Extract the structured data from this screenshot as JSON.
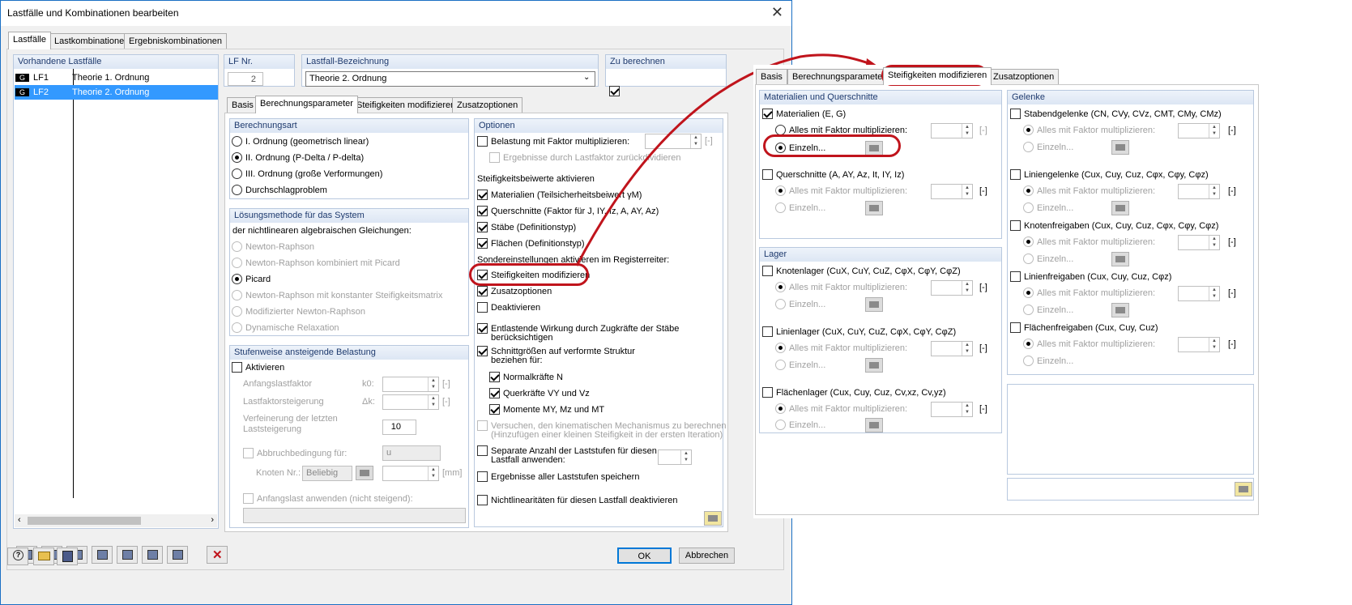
{
  "window": {
    "title": "Lastfälle und Kombinationen bearbeiten"
  },
  "top_tabs": [
    "Lastfälle",
    "Lastkombinationen",
    "Ergebniskombinationen"
  ],
  "loadcases": {
    "header": "Vorhandene Lastfälle",
    "items": [
      {
        "tag": "G",
        "id": "LF1",
        "name": "Theorie 1. Ordnung"
      },
      {
        "tag": "G",
        "id": "LF2",
        "name": "Theorie 2. Ordnung"
      }
    ]
  },
  "lf_nr": {
    "label": "LF Nr.",
    "value": "2"
  },
  "bezeichnung": {
    "label": "Lastfall-Bezeichnung",
    "value": "Theorie 2. Ordnung"
  },
  "zu_berechnen": {
    "label": "Zu berechnen"
  },
  "inner_tabs": [
    "Basis",
    "Berechnungsparameter",
    "Steifigkeiten modifizieren",
    "Zusatzoptionen"
  ],
  "berechnungsart": {
    "header": "Berechnungsart",
    "options": [
      "I. Ordnung (geometrisch linear)",
      "II. Ordnung (P-Delta / P-delta)",
      "III. Ordnung (große Verformungen)",
      "Durchschlagproblem"
    ]
  },
  "loesung": {
    "header": "Lösungsmethode für das System",
    "intro": "der nichtlinearen algebraischen Gleichungen:",
    "options": [
      "Newton-Raphson",
      "Newton-Raphson kombiniert mit Picard",
      "Picard",
      "Newton-Raphson mit konstanter Steifigkeitsmatrix",
      "Modifizierter Newton-Raphson",
      "Dynamische Relaxation"
    ]
  },
  "stufen": {
    "header": "Stufenweise ansteigende Belastung",
    "aktivieren": "Aktivieren",
    "anfang": "Anfangslastfaktor",
    "anfang_sym": "k0:",
    "steig": "Lastfaktorsteigerung",
    "steig_sym": "Δk:",
    "verf1": "Verfeinerung der letzten",
    "verf2": "Laststeigerung",
    "verf_val": "10",
    "abbruch": "Abbruchbedingung für:",
    "abbruch_val": "u",
    "knoten": "Knoten Nr.:",
    "knoten_val": "Beliebig",
    "mm": "[mm]",
    "anfangslast": "Anfangslast anwenden (nicht steigend):",
    "unit": "[-]"
  },
  "optionen": {
    "header": "Optionen",
    "faktor": "Belastung mit Faktor multiplizieren:",
    "ergebnisse": "Ergebnisse durch Lastfaktor zurückdividieren",
    "steif_head": "Steifigkeitsbeiwerte aktivieren",
    "mat": "Materialien (Teilsicherheitsbeiwert γM)",
    "qs": "Querschnitte (Faktor für J, IY, Iz, A, AY, Az)",
    "staebe": "Stäbe (Definitionstyp)",
    "flaechen": "Flächen (Definitionstyp)",
    "sonder": "Sondereinstellungen aktivieren im Registerreiter:",
    "steifmod": "Steifigkeiten modifizieren",
    "zusatz": "Zusatzoptionen",
    "deakt": "Deaktivieren",
    "entlast1": "Entlastende Wirkung durch Zugkräfte der Stäbe",
    "entlast2": "berücksichtigen",
    "schnitt1": "Schnittgrößen auf verformte Struktur",
    "schnitt2": "beziehen für:",
    "normal": "Normalkräfte N",
    "quer": "Querkräfte VY und Vz",
    "momente": "Momente MY, Mz und MT",
    "vers1": "Versuchen, den kinematischen Mechanismus zu berechnen",
    "vers2": "(Hinzufügen einer kleinen Steifigkeit in der ersten Iteration)",
    "sep1": "Separate Anzahl der Laststufen für diesen",
    "sep2": "Lastfall anwenden:",
    "erg_all": "Ergebnisse aller Laststufen speichern",
    "nonlin": "Nichtlinearitäten für diesen Lastfall deaktivieren",
    "unit": "[-]"
  },
  "footer": {
    "ok": "OK",
    "cancel": "Abbrechen"
  },
  "right_tabs": [
    "Basis",
    "Berechnungsparameter",
    "Steifigkeiten modifizieren",
    "Zusatzoptionen"
  ],
  "mq": {
    "header": "Materialien und Querschnitte",
    "mat": "Materialien (E, G)",
    "alles": "Alles mit Faktor multiplizieren:",
    "einzeln": "Einzeln...",
    "qs": "Querschnitte (A, AY, Az, It, IY, Iz)",
    "einzeln2": "Einzeln...",
    "unit": "[-]"
  },
  "lager": {
    "header": "Lager",
    "knoten": "Knotenlager (CuX, CuY, CuZ, CφX, CφY, CφZ)",
    "linien": "Linienlager (CuX, CuY, CuZ, CφX, CφY, CφZ)",
    "flaechen": "Flächenlager (Cux, Cuy, Cuz, Cv,xz, Cv,yz)",
    "alles": "Alles mit Faktor multiplizieren:",
    "einzeln": "Einzeln...",
    "unit": "[-]"
  },
  "gelenke": {
    "header": "Gelenke",
    "stab": "Stabendgelenke (CN, CVy, CVz, CMT, CMy, CMz)",
    "linie": "Liniengelenke (Cux, Cuy, Cuz, Cφx, Cφy, Cφz)",
    "knotenf": "Knotenfreigaben (Cux, Cuy, Cuz, Cφx, Cφy, Cφz)",
    "linienf": "Linienfreigaben (Cux, Cuy, Cuz, Cφz)",
    "flaechenf": "Flächenfreigaben (Cux, Cuy, Cuz)",
    "alles": "Alles mit Faktor multiplizieren:",
    "einzeln": "Einzeln...",
    "unit": "[-]"
  },
  "colors": {
    "accent": "#c0141c",
    "selection": "#3399ff",
    "header_text": "#1e3a6e"
  }
}
